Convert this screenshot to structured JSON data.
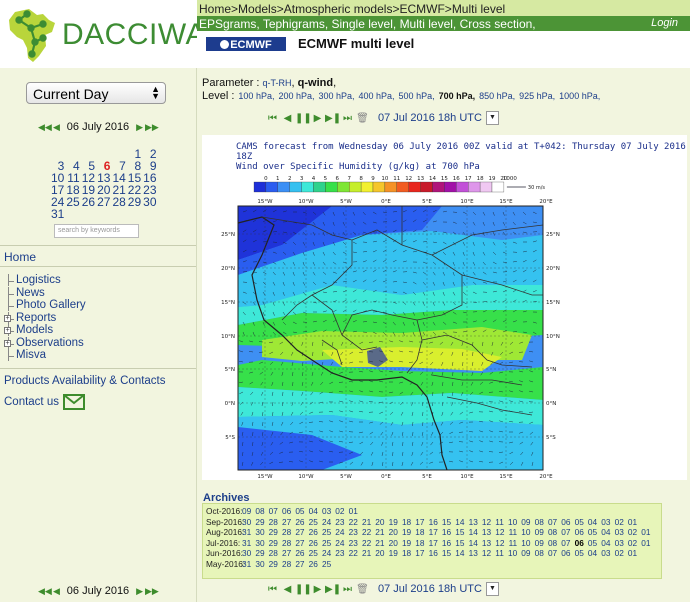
{
  "header": {
    "logo_text": "DACCIWA",
    "breadcrumb": [
      "Home",
      "Models",
      "Atmospheric models",
      "ECMWF",
      "Multi level"
    ],
    "breadcrumb_sep": ">",
    "subnav": [
      "EPSgrams",
      "Tephigrams",
      "Single level",
      "Multi level",
      "Cross section"
    ],
    "login": "Login",
    "ecmwf_logo": "ECMWF",
    "page_title": "ECMWF multi level"
  },
  "sidebar": {
    "day_select": "Current Day",
    "date_label": "06 July 2016",
    "calendar": [
      [
        "",
        "",
        "",
        "",
        "",
        "1",
        "2"
      ],
      [
        "3",
        "4",
        "5",
        "6",
        "7",
        "8",
        "9"
      ],
      [
        "10",
        "11",
        "12",
        "13",
        "14",
        "15",
        "16"
      ],
      [
        "17",
        "18",
        "19",
        "20",
        "21",
        "22",
        "23"
      ],
      [
        "24",
        "25",
        "26",
        "27",
        "28",
        "29",
        "30"
      ],
      [
        "31",
        "",
        "",
        "",
        "",
        "",
        ""
      ]
    ],
    "calendar_today": "6",
    "search_placeholder": "search by keywords",
    "home": "Home",
    "nav": [
      {
        "label": "Logistics",
        "expandable": false
      },
      {
        "label": "News",
        "expandable": false
      },
      {
        "label": "Photo Gallery",
        "expandable": false
      },
      {
        "label": "Reports",
        "expandable": true
      },
      {
        "label": "Models",
        "expandable": true
      },
      {
        "label": "Observations",
        "expandable": true
      },
      {
        "label": "Misva",
        "expandable": false
      }
    ],
    "products": "Products Availability & Contacts",
    "contact": "Contact us"
  },
  "main": {
    "parameter_label": "Parameter :",
    "parameters": [
      "q-T-RH",
      "q-wind"
    ],
    "parameter_selected": "q-wind",
    "level_label": "Level :",
    "levels": [
      "100 hPa",
      "200 hPa",
      "300 hPa",
      "400 hPa",
      "500 hPa",
      "700 hPa",
      "850 hPa",
      "925 hPa",
      "1000 hPa"
    ],
    "level_selected": "700 hPa",
    "time": "07 Jul 2016 18h UTC",
    "map": {
      "title_1": "CAMS forecast from Wednesday 06 July 2016 00Z valid at T+042: Thursday 07 July 2016 18Z",
      "title_2": "Wind over Specific Humidity (g/kg) at 700 hPa",
      "colorbar_ticks": [
        "0",
        "1",
        "2",
        "3",
        "4",
        "5",
        "6",
        "7",
        "8",
        "9",
        "10",
        "11",
        "12",
        "13",
        "14",
        "15",
        "16",
        "17",
        "18",
        "19",
        "20"
      ],
      "colorbar_extra": "1000",
      "wind_legend": "30 m/s",
      "lon_labels": [
        "15°W",
        "10°W",
        "5°W",
        "0°E",
        "5°E",
        "10°E",
        "15°E",
        "20°E"
      ],
      "lat_labels": [
        "25°N",
        "20°N",
        "15°N",
        "10°N",
        "5°N",
        "0°N",
        "5°S"
      ],
      "colors": [
        "#1e2fd8",
        "#2a5cf0",
        "#3b8ff5",
        "#35c0f0",
        "#3ee8d8",
        "#2fd28c",
        "#37e04a",
        "#7fe635",
        "#c6ee2c",
        "#f2f030",
        "#f5c62b",
        "#f59226",
        "#f25c21",
        "#e8261d",
        "#c81a2a",
        "#b0147a",
        "#a110a8",
        "#c250d8",
        "#de96ea",
        "#f0c8f2"
      ]
    },
    "archives_title": "Archives",
    "archives": [
      {
        "month": "Oct-2016:",
        "days": [
          "09",
          "08",
          "07",
          "06",
          "05",
          "04",
          "03",
          "02",
          "01"
        ]
      },
      {
        "month": "Sep-2016:",
        "days": [
          "30",
          "29",
          "28",
          "27",
          "26",
          "25",
          "24",
          "23",
          "22",
          "21",
          "20",
          "19",
          "18",
          "17",
          "16",
          "15",
          "14",
          "13",
          "12",
          "11",
          "10",
          "09",
          "08",
          "07",
          "06",
          "05",
          "04",
          "03",
          "02",
          "01"
        ]
      },
      {
        "month": "Aug-2016:",
        "days": [
          "31",
          "30",
          "29",
          "28",
          "27",
          "26",
          "25",
          "24",
          "23",
          "22",
          "21",
          "20",
          "19",
          "18",
          "17",
          "16",
          "15",
          "14",
          "13",
          "12",
          "11",
          "10",
          "09",
          "08",
          "07",
          "06",
          "05",
          "04",
          "03",
          "02",
          "01"
        ]
      },
      {
        "month": "Jul-2016:",
        "days": [
          "31",
          "30",
          "29",
          "28",
          "27",
          "26",
          "25",
          "24",
          "23",
          "22",
          "21",
          "20",
          "19",
          "18",
          "17",
          "16",
          "15",
          "14",
          "13",
          "12",
          "11",
          "10",
          "09",
          "08",
          "07",
          "06",
          "05",
          "04",
          "03",
          "02",
          "01"
        ],
        "current": "06"
      },
      {
        "month": "Jun-2016:",
        "days": [
          "30",
          "29",
          "28",
          "27",
          "26",
          "25",
          "24",
          "23",
          "22",
          "21",
          "20",
          "19",
          "18",
          "17",
          "16",
          "15",
          "14",
          "13",
          "12",
          "11",
          "10",
          "09",
          "08",
          "07",
          "06",
          "05",
          "04",
          "03",
          "02",
          "01"
        ]
      },
      {
        "month": "May-2016:",
        "days": [
          "31",
          "30",
          "29",
          "28",
          "27",
          "26",
          "25"
        ]
      }
    ]
  }
}
